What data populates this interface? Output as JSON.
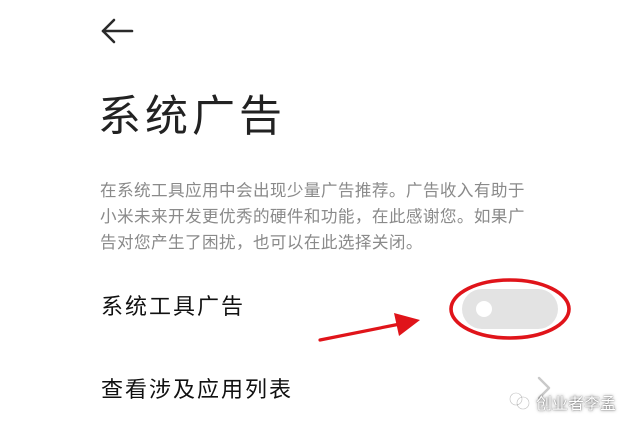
{
  "header": {
    "back_icon": "arrow-left-icon",
    "title": "系统广告"
  },
  "description": {
    "line1": "在系统工具应用中会出现少量广告推荐。广告收入有助于",
    "line2": "小米未来开发更优秀的硬件和功能，在此感谢您。如果广",
    "line3": "告对您产生了困扰，也可以在此选择关闭。"
  },
  "settings": {
    "system_tool_ads": {
      "label": "系统工具广告",
      "toggle_on": false
    },
    "related_apps": {
      "label": "查看涉及应用列表",
      "icon": "chevron-right-icon"
    }
  },
  "annotations": {
    "highlight_color": "#e0141a",
    "arrow_color": "#e0141a"
  },
  "watermark": {
    "text": "创业者李孟",
    "icon": "wechat-channel-icon"
  }
}
